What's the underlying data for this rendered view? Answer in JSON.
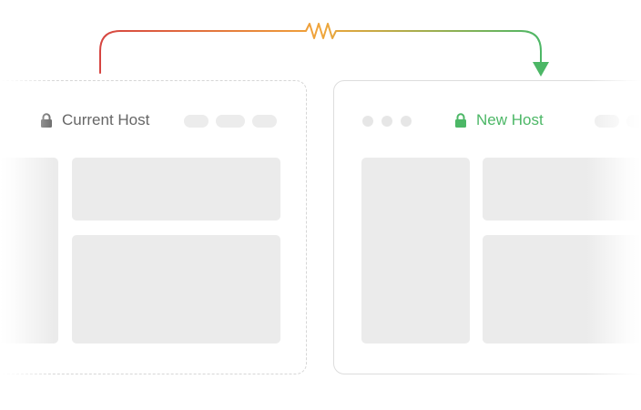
{
  "connector": {
    "icon": "resistor-squiggle-icon",
    "gradient_start": "#d64541",
    "gradient_mid": "#f0a53a",
    "gradient_end": "#4cb766",
    "arrow_color": "#4cb766"
  },
  "current_host": {
    "label": "Current Host",
    "label_color": "#666666",
    "lock_color": "#666666",
    "icon": "lock-icon"
  },
  "new_host": {
    "label": "New Host",
    "label_color": "#4cb766",
    "lock_color": "#4cb766",
    "icon": "lock-icon"
  },
  "colors": {
    "placeholder": "#ebebeb",
    "pill": "#ececec",
    "traffic_dot": "#e6e6e6",
    "border_dashed": "#d6d6d6",
    "border_solid": "#dddddd"
  }
}
